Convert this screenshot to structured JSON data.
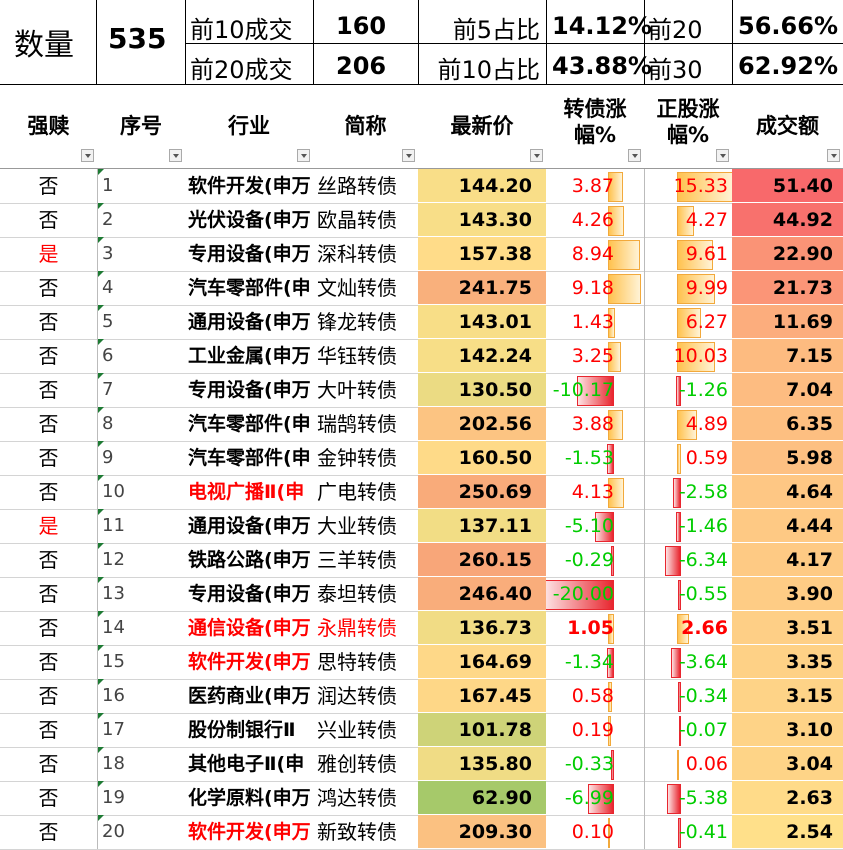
{
  "summary": {
    "count_label": "数量",
    "count_value": "535",
    "row1": [
      {
        "label": "前10成交",
        "value": "160"
      },
      {
        "label": "前5占比",
        "value": "14.12%"
      },
      {
        "label": "前20",
        "value": "56.66%"
      }
    ],
    "row2": [
      {
        "label": "前20成交",
        "value": "206"
      },
      {
        "label": "前10占比",
        "value": "43.88%"
      },
      {
        "label": "前30",
        "value": "62.92%"
      }
    ]
  },
  "headers": [
    "强赎",
    "序号",
    "行业",
    "简称",
    "最新价",
    "转债涨\n幅%",
    "正股涨\n幅%",
    "成交额"
  ],
  "colors": {
    "text_red": "#ff0000",
    "text_green": "#00cc00",
    "bar_gold": "#ffc24f",
    "bar_red": "#e8262f",
    "price_low": "#a6c96a",
    "price_mid": "#ffe08a",
    "price_high": "#f8a679",
    "volume_high": "#f8696b",
    "volume_low": "#ffe08a"
  },
  "rows": [
    {
      "redeem": "否",
      "no": "1",
      "industry": "软件开发(申万",
      "name": "丝路转债",
      "price": "144.20",
      "cb": "3.87",
      "cb_v": 3.87,
      "stock": "15.33",
      "stock_v": 15.33,
      "vol": "51.40",
      "industry_red": false,
      "name_red": false,
      "cb_red_text": true
    },
    {
      "redeem": "否",
      "no": "2",
      "industry": "光伏设备(申万",
      "name": "欧晶转债",
      "price": "143.30",
      "cb": "4.26",
      "cb_v": 4.26,
      "stock": "4.27",
      "stock_v": 4.27,
      "vol": "44.92",
      "industry_red": false,
      "name_red": false
    },
    {
      "redeem": "是",
      "no": "3",
      "industry": "专用设备(申万",
      "name": "深科转债",
      "price": "157.38",
      "cb": "8.94",
      "cb_v": 8.94,
      "stock": "9.61",
      "stock_v": 9.61,
      "vol": "22.90",
      "industry_red": false,
      "name_red": false
    },
    {
      "redeem": "否",
      "no": "4",
      "industry": "汽车零部件(申",
      "name": "文灿转债",
      "price": "241.75",
      "cb": "9.18",
      "cb_v": 9.18,
      "stock": "9.99",
      "stock_v": 9.99,
      "vol": "21.73",
      "industry_red": false,
      "name_red": false
    },
    {
      "redeem": "否",
      "no": "5",
      "industry": "通用设备(申万",
      "name": "锋龙转债",
      "price": "143.01",
      "cb": "1.43",
      "cb_v": 1.43,
      "stock": "6.27",
      "stock_v": 6.27,
      "vol": "11.69",
      "industry_red": false,
      "name_red": false
    },
    {
      "redeem": "否",
      "no": "6",
      "industry": "工业金属(申万",
      "name": "华钰转债",
      "price": "142.24",
      "cb": "3.25",
      "cb_v": 3.25,
      "stock": "10.03",
      "stock_v": 10.03,
      "vol": "7.15",
      "industry_red": false,
      "name_red": false
    },
    {
      "redeem": "否",
      "no": "7",
      "industry": "专用设备(申万",
      "name": "大叶转债",
      "price": "130.50",
      "cb": "-10.17",
      "cb_v": -10.17,
      "stock": "-1.26",
      "stock_v": -1.26,
      "vol": "7.04",
      "industry_red": false,
      "name_red": false
    },
    {
      "redeem": "否",
      "no": "8",
      "industry": "汽车零部件(申",
      "name": "瑞鹄转债",
      "price": "202.56",
      "cb": "3.88",
      "cb_v": 3.88,
      "stock": "4.89",
      "stock_v": 4.89,
      "vol": "6.35",
      "industry_red": false,
      "name_red": false
    },
    {
      "redeem": "否",
      "no": "9",
      "industry": "汽车零部件(申",
      "name": "金钟转债",
      "price": "160.50",
      "cb": "-1.53",
      "cb_v": -1.53,
      "stock": "0.59",
      "stock_v": 0.59,
      "vol": "5.98",
      "industry_red": false,
      "name_red": false
    },
    {
      "redeem": "否",
      "no": "10",
      "industry": "电视广播Ⅱ(申",
      "name": "广电转债",
      "price": "250.69",
      "cb": "4.13",
      "cb_v": 4.13,
      "stock": "-2.58",
      "stock_v": -2.58,
      "vol": "4.64",
      "industry_red": true,
      "name_red": false
    },
    {
      "redeem": "是",
      "no": "11",
      "industry": "通用设备(申万",
      "name": "大业转债",
      "price": "137.11",
      "cb": "-5.10",
      "cb_v": -5.1,
      "stock": "-1.46",
      "stock_v": -1.46,
      "vol": "4.44",
      "industry_red": false,
      "name_red": false
    },
    {
      "redeem": "否",
      "no": "12",
      "industry": "铁路公路(申万",
      "name": "三羊转债",
      "price": "260.15",
      "cb": "-0.29",
      "cb_v": -0.29,
      "stock": "-6.34",
      "stock_v": -6.34,
      "vol": "4.17",
      "industry_red": false,
      "name_red": false
    },
    {
      "redeem": "否",
      "no": "13",
      "industry": "专用设备(申万",
      "name": "泰坦转债",
      "price": "246.40",
      "cb": "-20.00",
      "cb_v": -20.0,
      "stock": "-0.55",
      "stock_v": -0.55,
      "vol": "3.90",
      "industry_red": false,
      "name_red": false
    },
    {
      "redeem": "否",
      "no": "14",
      "industry": "通信设备(申万",
      "name": "永鼎转债",
      "price": "136.73",
      "cb": "1.05",
      "cb_v": 1.05,
      "stock": "2.66",
      "stock_v": 2.66,
      "vol": "3.51",
      "industry_red": true,
      "name_red": true
    },
    {
      "redeem": "否",
      "no": "15",
      "industry": "软件开发(申万",
      "name": "思特转债",
      "price": "164.69",
      "cb": "-1.34",
      "cb_v": -1.34,
      "stock": "-3.64",
      "stock_v": -3.64,
      "vol": "3.35",
      "industry_red": true,
      "name_red": false
    },
    {
      "redeem": "否",
      "no": "16",
      "industry": "医药商业(申万",
      "name": "润达转债",
      "price": "167.45",
      "cb": "0.58",
      "cb_v": 0.58,
      "stock": "-0.34",
      "stock_v": -0.34,
      "vol": "3.15",
      "industry_red": false,
      "name_red": false
    },
    {
      "redeem": "否",
      "no": "17",
      "industry": "股份制银行Ⅱ",
      "name": "兴业转债",
      "price": "101.78",
      "cb": "0.19",
      "cb_v": 0.19,
      "stock": "-0.07",
      "stock_v": -0.07,
      "vol": "3.10",
      "industry_red": false,
      "name_red": false
    },
    {
      "redeem": "否",
      "no": "18",
      "industry": "其他电子Ⅱ(申",
      "name": "雅创转债",
      "price": "135.80",
      "cb": "-0.33",
      "cb_v": -0.33,
      "stock": "0.06",
      "stock_v": 0.06,
      "vol": "3.04",
      "industry_red": false,
      "name_red": false
    },
    {
      "redeem": "否",
      "no": "19",
      "industry": "化学原料(申万",
      "name": "鸿达转债",
      "price": "62.90",
      "cb": "-6.99",
      "cb_v": -6.99,
      "stock": "-5.38",
      "stock_v": -5.38,
      "vol": "2.63",
      "industry_red": false,
      "name_red": false
    },
    {
      "redeem": "否",
      "no": "20",
      "industry": "软件开发(申万",
      "name": "新致转债",
      "price": "209.30",
      "cb": "0.10",
      "cb_v": 0.1,
      "stock": "-0.41",
      "stock_v": -0.41,
      "vol": "2.54",
      "industry_red": true,
      "name_red": false
    }
  ]
}
